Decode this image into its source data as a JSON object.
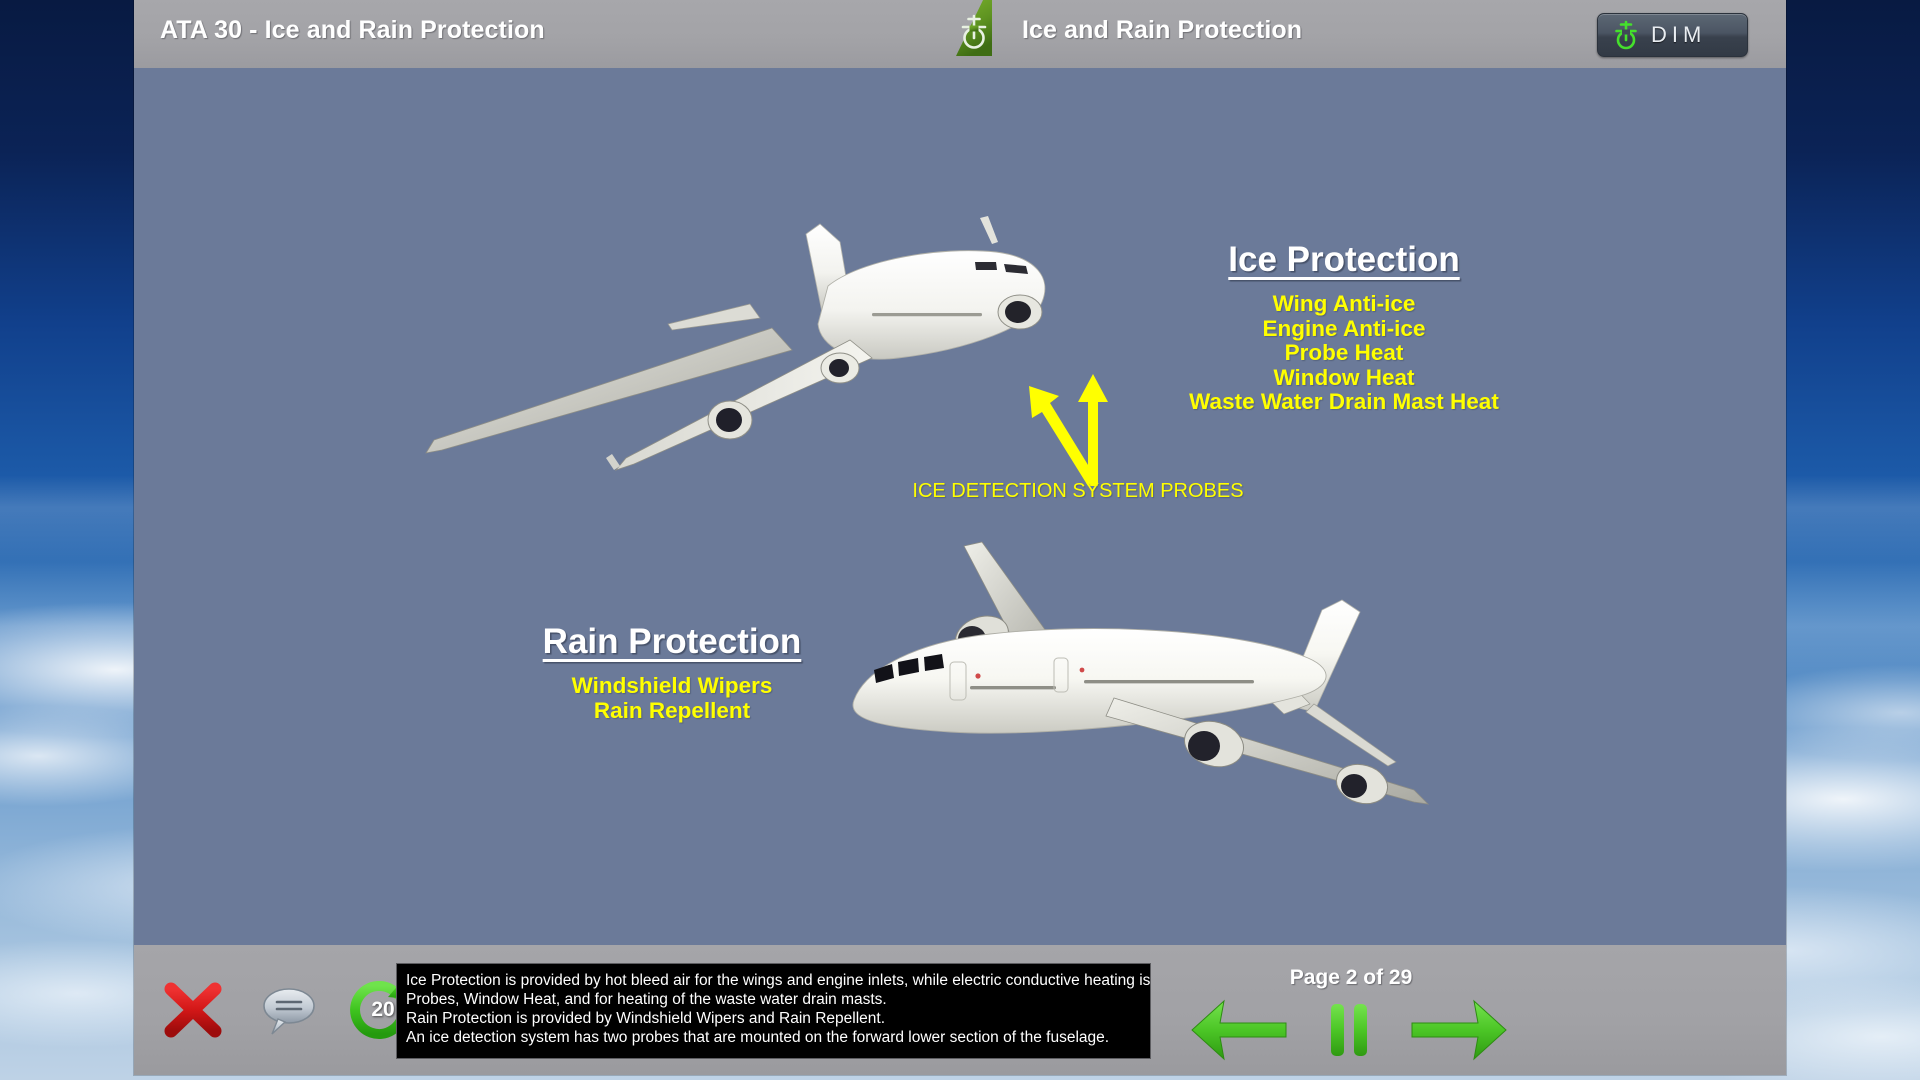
{
  "header": {
    "title_left": "ATA 30 - Ice and Rain Protection",
    "title_right": "Ice and Rain Protection",
    "logo_icon": "airline-tailfin-logo-icon",
    "dim_button": {
      "label": "DIM",
      "icon": "power-aircraft-icon",
      "accent_color": "#3ecf2e",
      "background_color": "#404a57"
    }
  },
  "slide": {
    "background_color": "#6b7a99",
    "ice_protection": {
      "heading": "Ice Protection",
      "items": [
        "Wing Anti-ice",
        "Engine Anti-ice",
        "Probe Heat",
        "Window Heat",
        "Waste Water Drain Mast Heat"
      ]
    },
    "rain_protection": {
      "heading": "Rain Protection",
      "items": [
        "Windshield Wipers",
        "Rain Repellent"
      ]
    },
    "callout": {
      "label": "ICE DETECTION SYSTEM PROBES",
      "arrow_color": "#ffff00",
      "arrow_count": 2
    },
    "graphics": [
      {
        "name": "aircraft-three-quarter-rear-view",
        "description": "white twin-engine airliner viewed from rear three-quarter, climbing"
      },
      {
        "name": "aircraft-three-quarter-front-view",
        "description": "white twin-engine airliner viewed from front three-quarter"
      }
    ],
    "heading_color": "#ffffff",
    "bullet_color": "#ffff00"
  },
  "footer": {
    "close_icon": "close-x-icon",
    "caption_icon": "speech-bubble-icon",
    "replay_icon": "replay-circular-arrow-icon",
    "replay_seconds": "20",
    "transcript_lines": [
      "Ice Protection is provided by hot bleed air for the wings and engine inlets, while electric conductive heating is provided for the",
      "Probes, Window Heat, and for heating of the waste water drain masts.",
      "Rain Protection is provided by Windshield Wipers and Rain Repellent.",
      "An ice detection system has two probes that are mounted on the forward lower section of the fuselage."
    ],
    "page_indicator": "Page 2 of 29",
    "prev_icon": "arrow-left-icon",
    "pause_icon": "pause-icon",
    "next_icon": "arrow-right-icon",
    "nav_accent_color": "#4ec526"
  }
}
